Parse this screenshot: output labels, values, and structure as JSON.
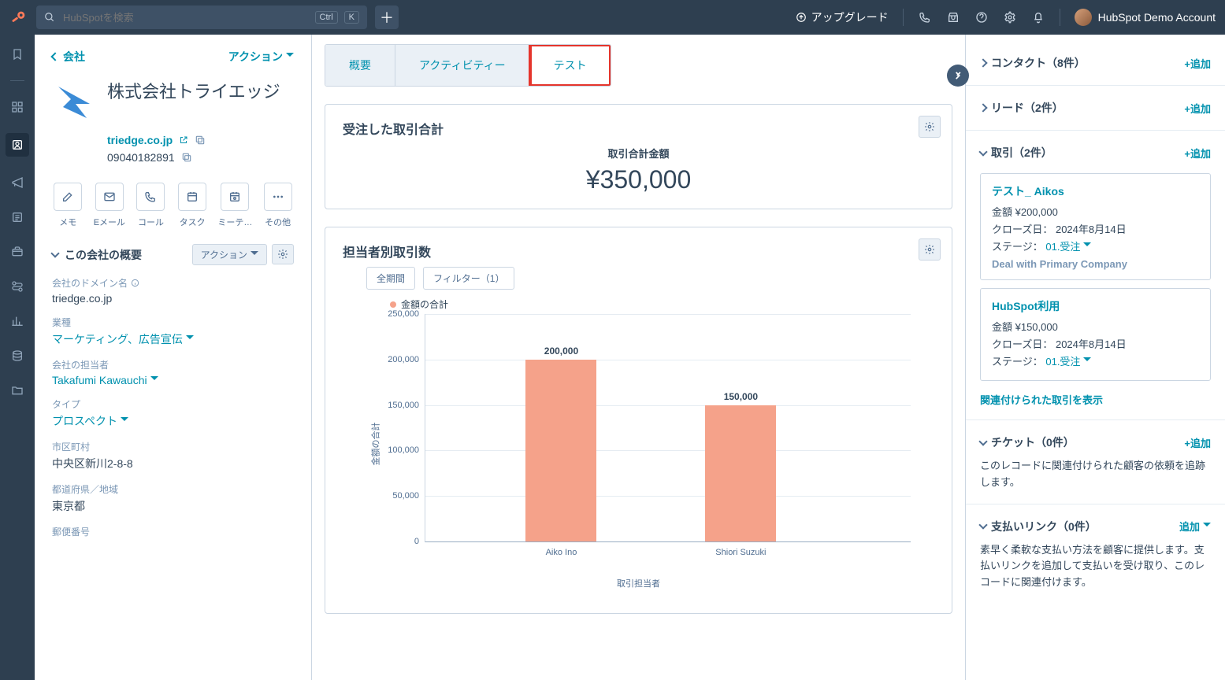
{
  "nav": {
    "search_placeholder": "HubSpotを検索",
    "ctrl": "Ctrl",
    "key": "K",
    "upgrade": "アップグレード",
    "account": "HubSpot Demo Account"
  },
  "left": {
    "back": "会社",
    "actions": "アクション",
    "company_name": "株式会社トライエッジ",
    "domain": "triedge.co.jp",
    "phone": "09040182891",
    "icon_btns": [
      "メモ",
      "Eメール",
      "コール",
      "タスク",
      "ミーテ…",
      "その他"
    ],
    "about_title": "この会社の概要",
    "about_action": "アクション",
    "fields": [
      {
        "label": "会社のドメイン名",
        "value": "triedge.co.jp",
        "info": true
      },
      {
        "label": "業種",
        "value": "マーケティング、広告宣伝",
        "select": true
      },
      {
        "label": "会社の担当者",
        "value": "Takafumi Kawauchi",
        "select": true
      },
      {
        "label": "タイプ",
        "value": "プロスペクト",
        "select": true
      },
      {
        "label": "市区町村",
        "value": "中央区新川2-8-8"
      },
      {
        "label": "都道府県／地域",
        "value": "東京都"
      },
      {
        "label": "郵便番号",
        "value": ""
      }
    ]
  },
  "main": {
    "tabs": [
      "概要",
      "アクティビティー",
      "テスト"
    ],
    "card1": {
      "title": "受注した取引合計",
      "total_label": "取引合計金額",
      "total_amount": "¥350,000"
    },
    "card2": {
      "title": "担当者別取引数",
      "filter_all": "全期間",
      "filter_count": "フィルター（1）",
      "legend": "金額の合計",
      "ylabel": "金額の合計",
      "xlabel": "取引担当者"
    }
  },
  "chart_data": {
    "type": "bar",
    "categories": [
      "Aiko Ino",
      "Shiori Suzuki"
    ],
    "values": [
      200000,
      150000
    ],
    "value_labels": [
      "200,000",
      "150,000"
    ],
    "ylim": [
      0,
      250000
    ],
    "yticks": [
      0,
      50000,
      100000,
      150000,
      200000,
      250000
    ],
    "ytick_labels": [
      "0",
      "50,000",
      "100,000",
      "150,000",
      "200,000",
      "250,000"
    ],
    "ylabel": "金額の合計",
    "xlabel": "取引担当者",
    "series_name": "金額の合計",
    "color": "#f5a28a"
  },
  "right": {
    "sections": {
      "contacts": {
        "title": "コンタクト（8件）",
        "add": "+追加"
      },
      "leads": {
        "title": "リード（2件）",
        "add": "+追加"
      },
      "deals": {
        "title": "取引（2件）",
        "add": "+追加"
      },
      "tickets": {
        "title": "チケット（0件）",
        "add": "+追加",
        "body": "このレコードに関連付けられた顧客の依頼を追跡します。"
      },
      "paylinks": {
        "title": "支払いリンク（0件）",
        "add": "追加",
        "body": "素早く柔軟な支払い方法を顧客に提供します。支払いリンクを追加して支払いを受け取り、このレコードに関連付けます。"
      }
    },
    "deals": [
      {
        "title": "テスト_ Aikos",
        "amount": "金額 ¥200,000",
        "close": "クローズ日： 2024年8月14日",
        "stage_label": "ステージ：",
        "stage": "01.受注",
        "assoc": "Deal with Primary Company"
      },
      {
        "title": "HubSpot利用",
        "amount": "金額 ¥150,000",
        "close": "クローズ日： 2024年8月14日",
        "stage_label": "ステージ：",
        "stage": "01.受注"
      }
    ],
    "deals_link": "関連付けられた取引を表示"
  }
}
